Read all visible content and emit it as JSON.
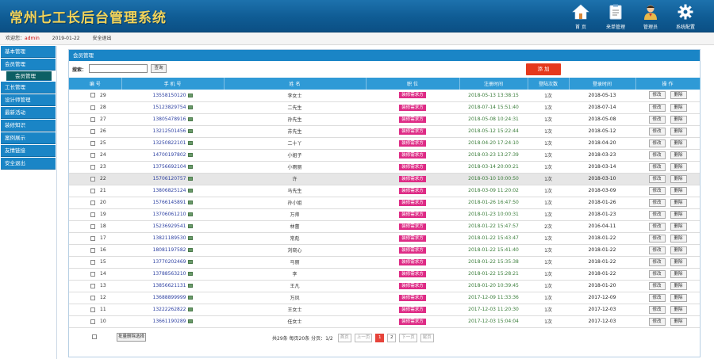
{
  "header": {
    "title": "常州七工长后台管理系统",
    "nav": [
      {
        "label": "首 页",
        "icon": "home-icon"
      },
      {
        "label": "来单管理",
        "icon": "clipboard-icon"
      },
      {
        "label": "管理员",
        "icon": "admin-icon"
      },
      {
        "label": "系统配置",
        "icon": "gear-icon"
      }
    ]
  },
  "subbar": {
    "welcome": "欢迎您：",
    "username": "admin",
    "date": "2019-01-22",
    "logout": "安全退出"
  },
  "sidebar": {
    "items": [
      {
        "label": "基本管理",
        "sub": false
      },
      {
        "label": "会员管理",
        "sub": false
      },
      {
        "label": "会员管理",
        "sub": true
      },
      {
        "label": "工长管理",
        "sub": false
      },
      {
        "label": "设计师管理",
        "sub": false
      },
      {
        "label": "最新活动",
        "sub": false
      },
      {
        "label": "装修知识",
        "sub": false
      },
      {
        "label": "案例展示",
        "sub": false
      },
      {
        "label": "友情链接",
        "sub": false
      },
      {
        "label": "安全退出",
        "sub": false
      }
    ]
  },
  "panel": {
    "title": "会员管理",
    "search_label": "搜索：",
    "search_value": "",
    "search_btn": "查询",
    "add_btn": "添 加"
  },
  "table": {
    "headers": [
      "编 号",
      "手 机 号",
      "姓 名",
      "职 位",
      "注册时间",
      "登陆次数",
      "登录时间",
      "操 作"
    ],
    "edit_label": "修改",
    "delete_label": "删除",
    "rows": [
      {
        "id": "29",
        "phone": "13558150120",
        "name": "李女士",
        "position": "装修需求方",
        "reg": "2018-05-13 13:38:15",
        "count": "1次",
        "last": "2018-05-13"
      },
      {
        "id": "28",
        "phone": "15123829754",
        "name": "二先生",
        "position": "装修需求方",
        "reg": "2018-07-14 15:51:40",
        "count": "1次",
        "last": "2018-07-14"
      },
      {
        "id": "27",
        "phone": "13805478916",
        "name": "孙先生",
        "position": "装修需求方",
        "reg": "2018-05-08 10:24:31",
        "count": "1次",
        "last": "2018-05-08"
      },
      {
        "id": "26",
        "phone": "13212501456",
        "name": "苏先生",
        "position": "装修需求方",
        "reg": "2018-05-12 15:22:44",
        "count": "1次",
        "last": "2018-05-12"
      },
      {
        "id": "25",
        "phone": "13250822101",
        "name": "二十丫",
        "position": "装修需求方",
        "reg": "2018-04-20 17:24:10",
        "count": "1次",
        "last": "2018-04-20"
      },
      {
        "id": "24",
        "phone": "14700197802",
        "name": "小姐子",
        "position": "装修需求方",
        "reg": "2018-03-23 13:27:39",
        "count": "1次",
        "last": "2018-03-23"
      },
      {
        "id": "23",
        "phone": "13756692104",
        "name": "小雨丽",
        "position": "装修需求方",
        "reg": "2018-03-14 20:00:21",
        "count": "1次",
        "last": "2018-03-14"
      },
      {
        "id": "22",
        "phone": "15706120757",
        "name": "许",
        "position": "装修需求方",
        "reg": "2018-03-10 10:00:50",
        "count": "1次",
        "last": "2018-03-10"
      },
      {
        "id": "21",
        "phone": "13806825124",
        "name": "马先生",
        "position": "装修需求方",
        "reg": "2018-03-09 11:20:02",
        "count": "1次",
        "last": "2018-03-09"
      },
      {
        "id": "20",
        "phone": "15766145891",
        "name": "孙小姐",
        "position": "装修需求方",
        "reg": "2018-01-26 16:47:50",
        "count": "1次",
        "last": "2018-01-26"
      },
      {
        "id": "19",
        "phone": "13706061210",
        "name": "万帅",
        "position": "装修需求方",
        "reg": "2018-01-23 10:00:31",
        "count": "1次",
        "last": "2018-01-23"
      },
      {
        "id": "18",
        "phone": "15236929541",
        "name": "林蕾",
        "position": "装修需求方",
        "reg": "2018-01-22 15:47:57",
        "count": "2次",
        "last": "2016-04-11"
      },
      {
        "id": "17",
        "phone": "13821189530",
        "name": "常彪",
        "position": "装修需求方",
        "reg": "2018-01-22 15:43:47",
        "count": "1次",
        "last": "2018-01-22"
      },
      {
        "id": "16",
        "phone": "18081197582",
        "name": "刘晓心",
        "position": "装修需求方",
        "reg": "2018-01-22 15:41:40",
        "count": "1次",
        "last": "2018-01-22"
      },
      {
        "id": "15",
        "phone": "13770202469",
        "name": "马丽",
        "position": "装修需求方",
        "reg": "2018-01-22 15:35:38",
        "count": "1次",
        "last": "2018-01-22"
      },
      {
        "id": "14",
        "phone": "13788563210",
        "name": "李",
        "position": "装修需求方",
        "reg": "2018-01-22 15:28:21",
        "count": "1次",
        "last": "2018-01-22"
      },
      {
        "id": "13",
        "phone": "13856621131",
        "name": "王凡",
        "position": "装修需求方",
        "reg": "2018-01-20 10:39:45",
        "count": "1次",
        "last": "2018-01-20"
      },
      {
        "id": "12",
        "phone": "13688899999",
        "name": "万凤",
        "position": "装修需求方",
        "reg": "2017-12-09 11:33:36",
        "count": "1次",
        "last": "2017-12-09"
      },
      {
        "id": "11",
        "phone": "13222262822",
        "name": "王女士",
        "position": "装修需求方",
        "reg": "2017-12-03 11:20:30",
        "count": "1次",
        "last": "2017-12-03"
      },
      {
        "id": "10",
        "phone": "13661190289",
        "name": "任女士",
        "position": "装修需求方",
        "reg": "2017-12-03 15:04:04",
        "count": "1次",
        "last": "2017-12-03"
      }
    ]
  },
  "footer": {
    "bulk_btn": "批量删除选择",
    "page_info": "共29条 每页20条 分页：",
    "page_of": "1/2",
    "first": "首页",
    "prev": "上一页",
    "pages": [
      "1",
      "2"
    ],
    "next": "下一页",
    "last": "尾页"
  }
}
